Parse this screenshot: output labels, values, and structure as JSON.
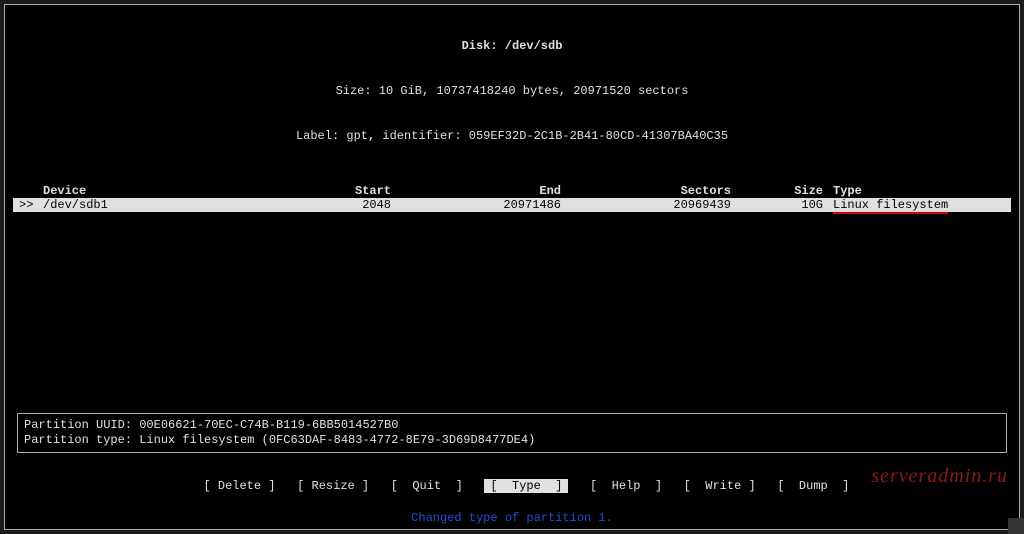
{
  "header": {
    "title_prefix": "Disk: ",
    "disk": "/dev/sdb",
    "size_line": "Size: 10 GiB, 10737418240 bytes, 20971520 sectors",
    "label_line": "Label: gpt, identifier: 059EF32D-2C1B-2B41-80CD-41307BA40C35"
  },
  "columns": {
    "device": "Device",
    "start": "Start",
    "end": "End",
    "sectors": "Sectors",
    "size": "Size",
    "type": "Type"
  },
  "rows": [
    {
      "selector": ">>",
      "device": "/dev/sdb1",
      "start": "2048",
      "end": "20971486",
      "sectors": "20969439",
      "size": "10G",
      "type": "Linux filesystem"
    }
  ],
  "partition_info": {
    "uuid_line": "Partition UUID: 00E06621-70EC-C74B-B119-6BB5014527B0",
    "type_line": "Partition type: Linux filesystem (0FC63DAF-8483-4772-8E79-3D69D8477DE4)"
  },
  "menu": {
    "delete": "Delete",
    "resize": "Resize",
    "quit": "Quit",
    "type": "Type",
    "help": "Help",
    "write": "Write",
    "dump": "Dump"
  },
  "status": "Changed type of partition 1.",
  "watermark": "serveradmin.ru"
}
